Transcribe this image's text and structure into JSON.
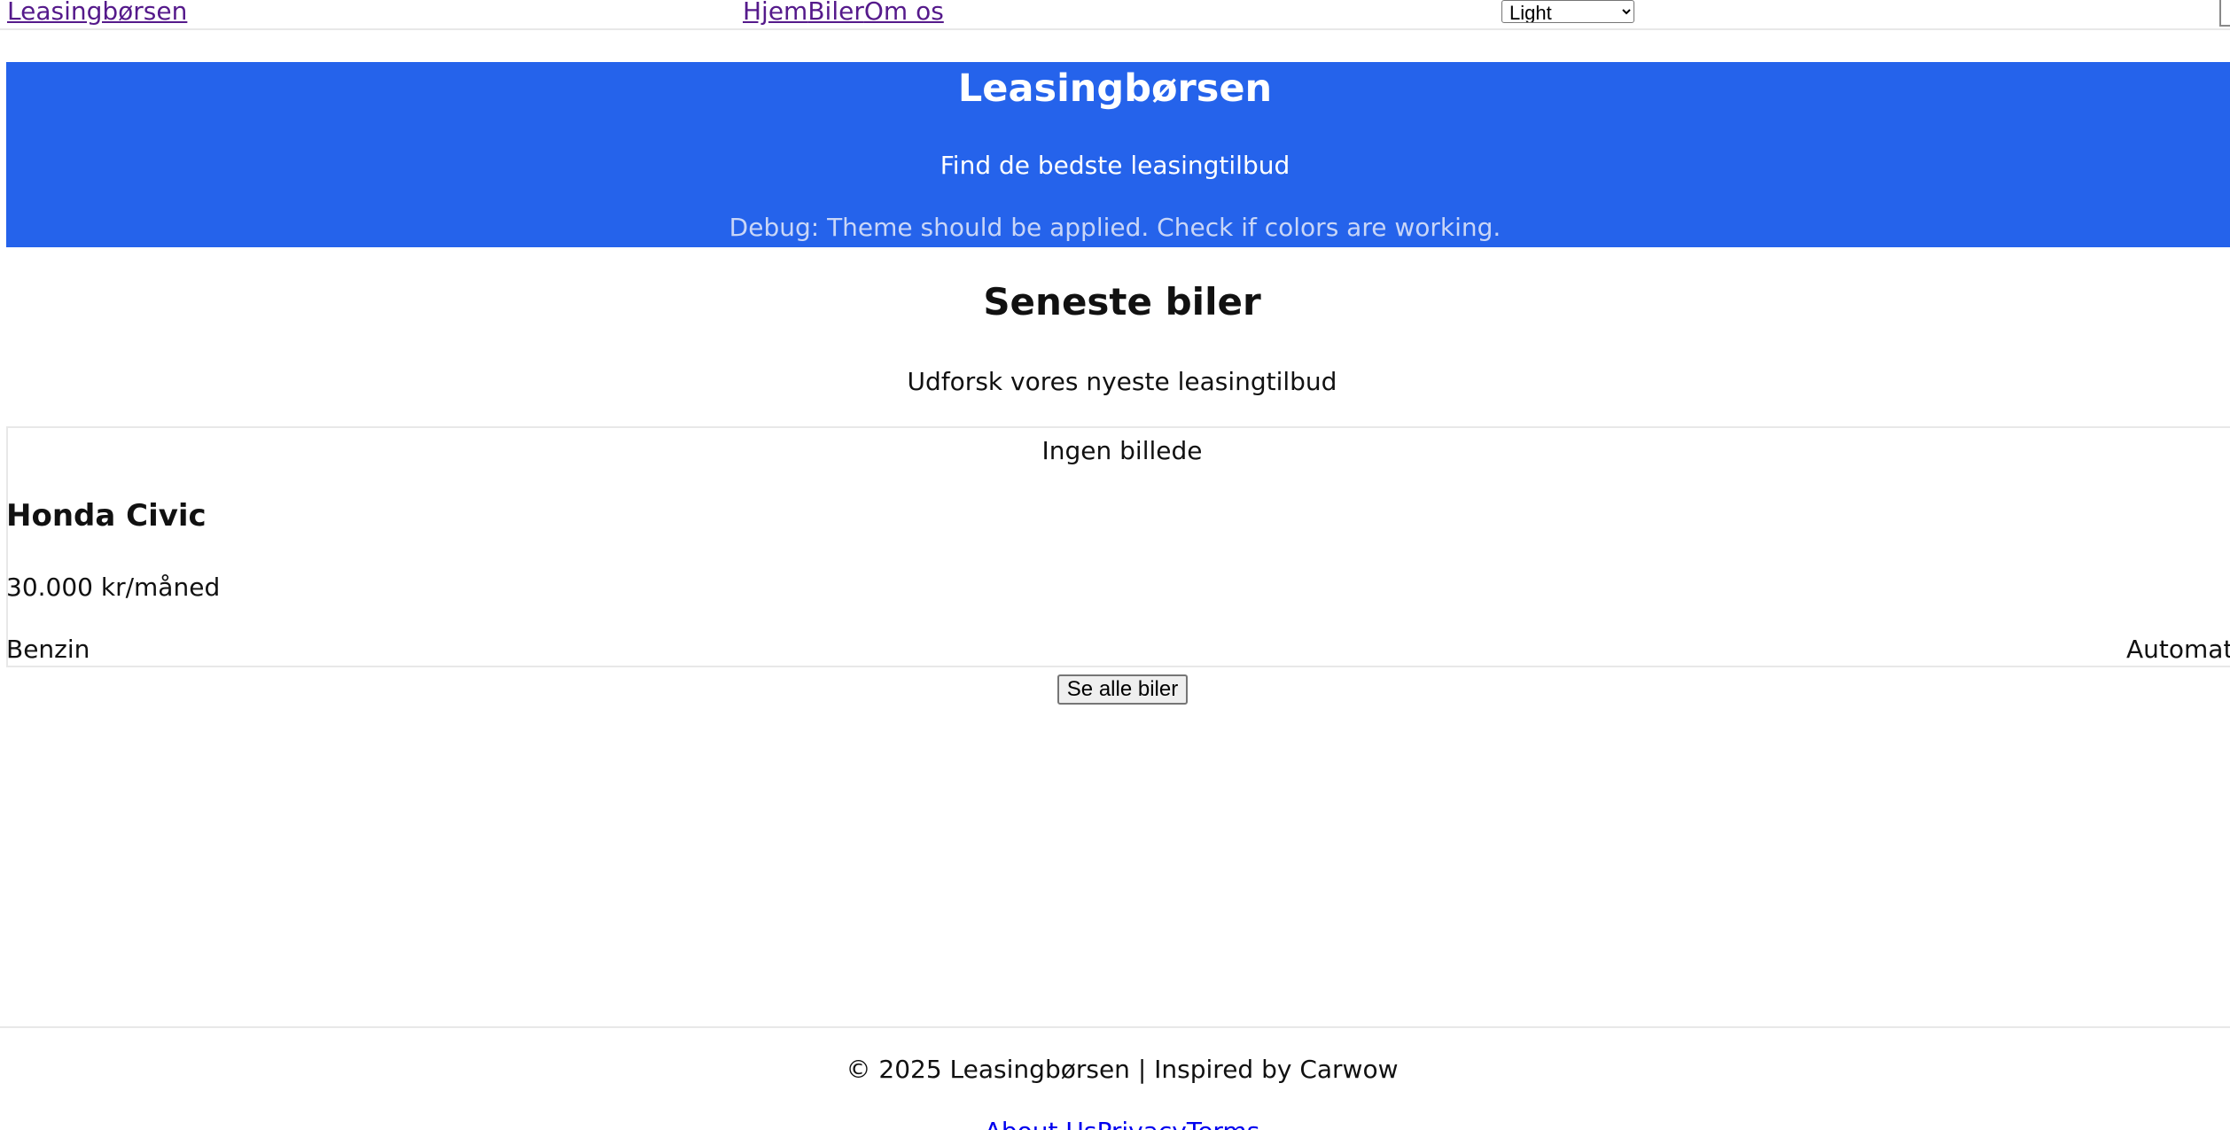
{
  "nav": {
    "brand": "Leasingbørsen",
    "links": [
      "Hjem",
      "Biler",
      "Om os"
    ],
    "theme_selected": "Light"
  },
  "hero": {
    "title": "Leasingbørsen",
    "subtitle": "Find de bedste leasingtilbud",
    "debug": "Debug: Theme should be applied. Check if colors are working."
  },
  "latest": {
    "title": "Seneste biler",
    "subtitle": "Udforsk vores nyeste leasingtilbud",
    "cars": [
      {
        "image_placeholder": "Ingen billede",
        "name": "Honda Civic",
        "price": "30.000 kr/måned",
        "fuel": "Benzin",
        "transmission": "Automatic"
      }
    ],
    "see_all_label": "Se alle biler"
  },
  "footer": {
    "copyright": "© 2025 Leasingbørsen | Inspired by Carwow",
    "links": [
      "About Us",
      "Privacy",
      "Terms"
    ]
  },
  "colors": {
    "hero_background": "#2563eb",
    "link_visited": "#551a8b",
    "link": "#0000ee"
  }
}
